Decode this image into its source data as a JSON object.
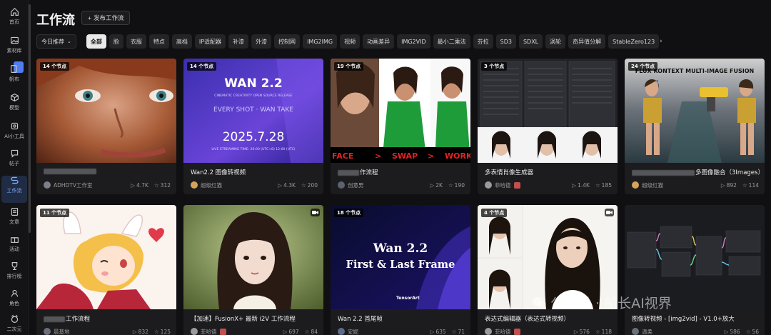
{
  "sidebar": {
    "items": [
      {
        "label": "首页",
        "icon": "home-icon"
      },
      {
        "label": "素材库",
        "icon": "image-icon"
      },
      {
        "label": "帆布",
        "icon": "canvas-icon"
      },
      {
        "label": "模型",
        "icon": "cube-icon"
      },
      {
        "label": "AI小工具",
        "icon": "tool-icon"
      },
      {
        "label": "帖子",
        "icon": "post-icon"
      },
      {
        "label": "工作流",
        "icon": "workflow-icon"
      },
      {
        "label": "文章",
        "icon": "article-icon"
      },
      {
        "label": "活动",
        "icon": "gift-icon"
      },
      {
        "label": "排行榜",
        "icon": "trophy-icon"
      },
      {
        "label": "角色",
        "icon": "character-icon"
      },
      {
        "label": "二次元",
        "icon": "anime-icon"
      }
    ],
    "active_index": 6
  },
  "header": {
    "title": "工作流",
    "publish_label": "发布工作流"
  },
  "filters": {
    "sort_label": "今日推荐",
    "chips": [
      "全部",
      "脸",
      "衣服",
      "特点",
      "高档",
      "IP适配器",
      "补漆",
      "外漆",
      "控制网",
      "IMG2IMG",
      "视频",
      "动画差异",
      "IMG2VID",
      "最小二乘法",
      "芬拉",
      "SD3",
      "SDXL",
      "涡轮",
      "奇异值分解",
      "StableZero123"
    ],
    "active_chip": "全部"
  },
  "cards": [
    {
      "nodes": "14 个节点",
      "title": "",
      "title_tail": "",
      "author": "ADHDTV工作室",
      "likes": "4.7K",
      "stars": "312",
      "video": false,
      "avatar_color": "#7a7f8a"
    },
    {
      "nodes": "14 个节点",
      "title": "Wan2.2 图像转视频",
      "title_tail": "",
      "author": "超级红猫",
      "likes": "4.3K",
      "stars": "200",
      "video": false,
      "avatar_color": "#d7a35a",
      "thumb_title": "WAN 2.2",
      "thumb_sub": "CINEMATIC CREATIVITY OPEN SOURCE RELEASE",
      "thumb_slogan": "EVERY SHOT · WAN TAKE",
      "thumb_date": "2025.7.28",
      "thumb_stream": "LIVE STREAMING TIME: 20:00 (UTC+8)  12:00 (UTC)"
    },
    {
      "nodes": "19 个节点",
      "title": "",
      "title_tail": "作流程",
      "author": "创意男",
      "likes": "2K",
      "stars": "190",
      "video": false,
      "avatar_color": "#5d6270",
      "thumb_words": [
        "FACE",
        ">",
        "SWAP",
        ">",
        "WORK"
      ]
    },
    {
      "nodes": "3 个节点",
      "title": "多表情肖像生成器",
      "title_tail": "",
      "author": "菲哈德",
      "likes": "1.4K",
      "stars": "185",
      "video": false,
      "avatar_color": "#9a9a9a"
    },
    {
      "nodes": "24 个节点",
      "title": "",
      "title_tail": "多图像融合（3Images）",
      "author": "超级红猫",
      "likes": "892",
      "stars": "114",
      "video": false,
      "avatar_color": "#d7a35a",
      "thumb_banner": "FLUX KONTEXT MULTI-IMAGE FUSION"
    },
    {
      "nodes": "11 个节点",
      "title": "",
      "title_tail": "工作流程",
      "author": "晨基地",
      "likes": "832",
      "stars": "125",
      "video": false,
      "avatar_color": "#6a6f7a"
    },
    {
      "nodes": "",
      "title": "【加速】FusionX+ 最新 i2V 工作流程",
      "title_tail": "",
      "author": "菲哈德",
      "likes": "697",
      "stars": "84",
      "video": true,
      "avatar_color": "#9a9a9a"
    },
    {
      "nodes": "18 个节点",
      "title": "Wan 2.2 首尾帧",
      "title_tail": "",
      "author": "安妮",
      "likes": "635",
      "stars": "71",
      "video": false,
      "avatar_color": "#5c6b8a",
      "thumb_title": "Wan 2.2",
      "thumb_sub": "First & Last Frame",
      "thumb_brand": "TensorArt"
    },
    {
      "nodes": "4 个节点",
      "title": "表达式编辑器（表达式转视频）",
      "title_tail": "",
      "author": "菲哈德",
      "likes": "576",
      "stars": "118",
      "video": true,
      "avatar_color": "#9a9a9a"
    },
    {
      "nodes": "",
      "title": "图像转视频 - [img2vid] - V1.0+放大",
      "title_tail": "",
      "author": "温柔",
      "likes": "586",
      "stars": "56",
      "video": false,
      "avatar_color": "#6a6f7a"
    }
  ],
  "watermark": "公众号 · 船长AI视界",
  "colors": {
    "accent": "#4e7ef0",
    "background": "#101012",
    "card": "#1c1c1f"
  }
}
